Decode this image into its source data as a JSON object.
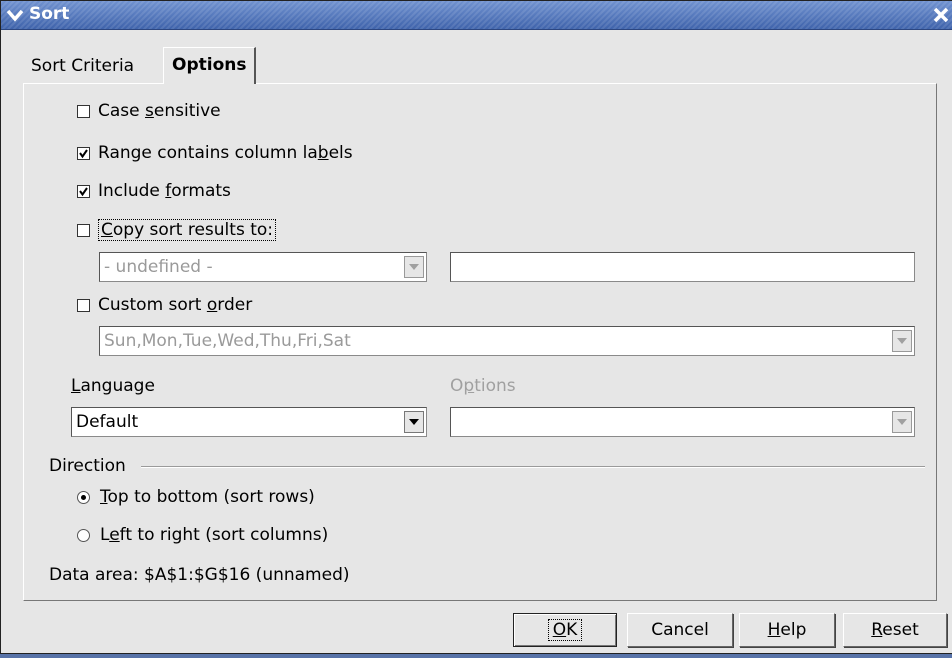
{
  "window": {
    "title": "Sort"
  },
  "tabs": [
    {
      "label": "Sort Criteria"
    },
    {
      "label": "Options"
    }
  ],
  "options": {
    "case_sensitive": {
      "pre": "Case ",
      "key": "s",
      "post": "ensitive",
      "checked": false
    },
    "column_labels": {
      "pre": "Range contains column la",
      "key": "b",
      "post": "els",
      "checked": true
    },
    "include_formats": {
      "pre": "Include ",
      "key": "f",
      "post": "ormats",
      "checked": true
    },
    "copy_results": {
      "pre": "",
      "key": "C",
      "post": "opy sort results to:",
      "checked": false
    },
    "copy_target_select": "- undefined -",
    "copy_target_input": "",
    "custom_order": {
      "pre": "Custom sort ",
      "key": "o",
      "post": "rder",
      "checked": false
    },
    "custom_order_select": "Sun,Mon,Tue,Wed,Thu,Fri,Sat",
    "language": {
      "key": "L",
      "post": "anguage",
      "value": "Default"
    },
    "lang_options": {
      "pre": "O",
      "key": "p",
      "post": "tions",
      "value": ""
    }
  },
  "direction": {
    "label": "Direction",
    "top_to_bottom": {
      "key": "T",
      "post": "op to bottom (sort rows)",
      "selected": true
    },
    "left_to_right": {
      "pre": "L",
      "key": "e",
      "post": "ft to right (sort columns)",
      "selected": false
    }
  },
  "data_area": "Data area: $A$1:$G$16 (unnamed)",
  "buttons": {
    "ok": {
      "key": "O",
      "post": "K"
    },
    "cancel": "Cancel",
    "help": {
      "key": "H",
      "post": "elp"
    },
    "reset": {
      "key": "R",
      "post": "eset"
    }
  },
  "colors": {
    "titlebar": "#4467ad",
    "dialog_bg": "#e6e6e6",
    "desktop": "#5873a8"
  }
}
